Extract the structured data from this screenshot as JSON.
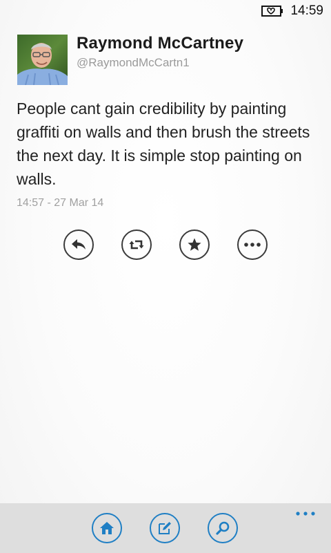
{
  "status_bar": {
    "time": "14:59",
    "battery_icon": "battery-charging-icon"
  },
  "tweet": {
    "author_name": "Raymond McCartney",
    "author_handle": "@RaymondMcCartn1",
    "text": "People cant gain credibility by painting graffiti on walls and then brush the streets the next day. It is simple stop painting on walls.",
    "timestamp": "14:57 - 27 Mar 14"
  },
  "actions": [
    {
      "icon": "reply-icon"
    },
    {
      "icon": "retweet-icon"
    },
    {
      "icon": "favorite-star-icon"
    },
    {
      "icon": "more-icon"
    }
  ],
  "app_bar": {
    "buttons": [
      {
        "icon": "home-icon"
      },
      {
        "icon": "compose-icon"
      },
      {
        "icon": "search-icon"
      }
    ],
    "more_icon": "ellipsis-icon",
    "accent_color": "#1f7fc4",
    "background_color": "#dedede"
  }
}
